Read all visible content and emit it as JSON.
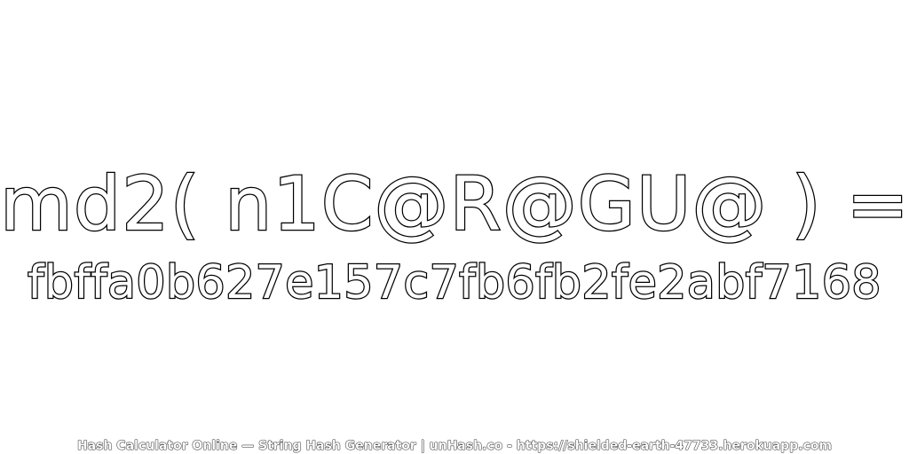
{
  "expression": "md2( n1C@R@GU@ ) =",
  "hash": "fbffa0b627e157c7fb6fb2fe2abf7168",
  "footer": "Hash Calculator Online — String Hash Generator | unHash.co - https://shielded-earth-47733.herokuapp.com",
  "colors": {
    "background": "#ffffff",
    "text_fill": "#ffffff",
    "text_outline": "#000000"
  }
}
